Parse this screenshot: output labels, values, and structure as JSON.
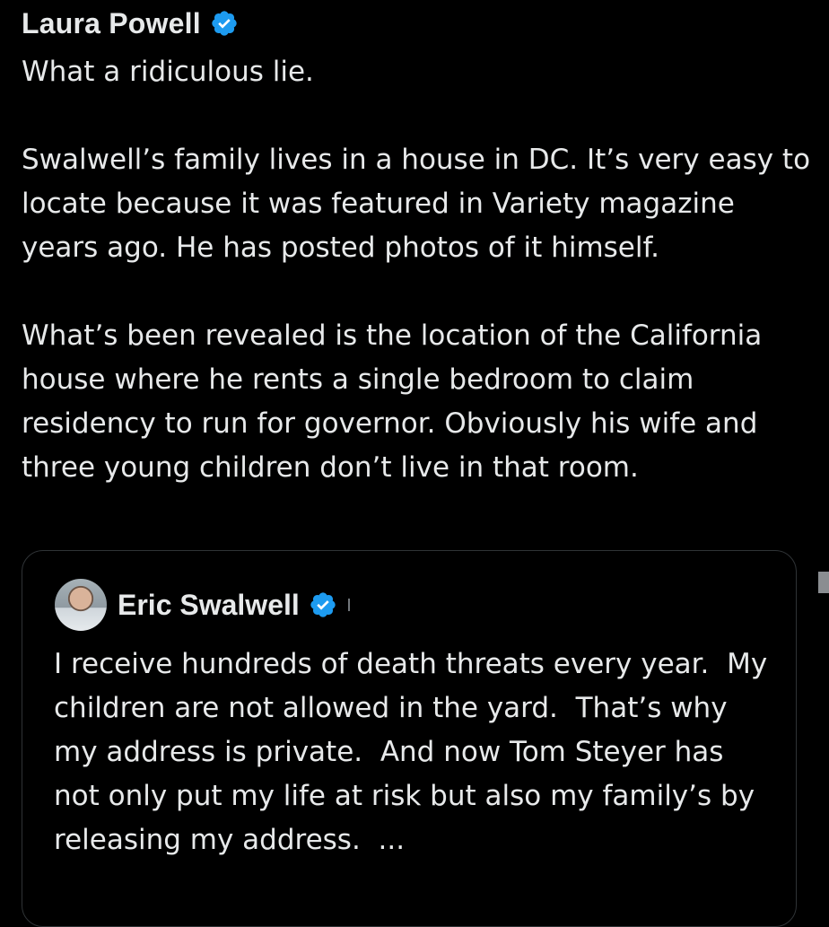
{
  "post": {
    "author_name": "Laura Powell",
    "paragraphs": [
      "What a ridiculous lie.",
      "Swalwell’s family lives in a house in DC. It’s very easy to locate because it was featured in Variety magazine years ago. He has posted photos of it himself.",
      "What’s been revealed is the location of the California house where he rents a single bedroom to claim residency to run for governor. Obviously his wife and three young children don’t live in that room."
    ]
  },
  "quote": {
    "author_name": "Eric Swalwell",
    "text": "I receive hundreds of death threats every year.  My children are not allowed in the yard.  That’s why my address is private.  And now Tom Steyer has not only put my life at risk but also my family’s by releasing my address.  ..."
  },
  "icons": {
    "verified_badge": "verified-badge-icon",
    "avatar": "avatar"
  },
  "colors": {
    "background": "#000000",
    "text": "#e7e9ea",
    "verified": "#1d9bf0",
    "border": "#2f3336"
  }
}
